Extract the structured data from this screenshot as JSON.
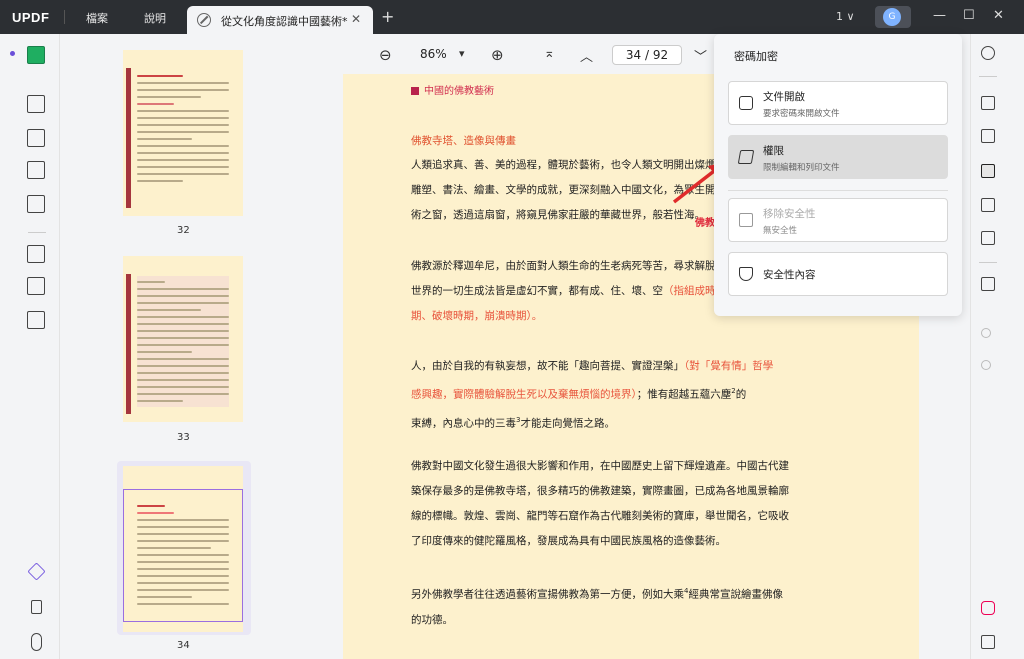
{
  "app": {
    "logo": "UPDF",
    "menu_file": "檔案",
    "menu_help": "說明",
    "tab_title": "從文化角度認識中國藝術*",
    "tab_close": "✕",
    "add_tab": "+",
    "page_count": "1 ∨",
    "avatar_initial": "G",
    "minimize": "—",
    "maximize": "☐",
    "close": "✕"
  },
  "toolbar": {
    "zoom_out": "⊖",
    "zoom": "86%",
    "zoom_dropdown": "▾",
    "zoom_in": "⊕",
    "first_page": "⌅",
    "prev_page": "︿",
    "page_input": "34 / 92",
    "next_page": "﹀"
  },
  "thumbnails": [
    {
      "label": "32"
    },
    {
      "label": "33"
    },
    {
      "label": "34"
    }
  ],
  "document": {
    "heading": "中國的佛教藝術",
    "subheading": "佛教寺塔、造像與傳畫",
    "p1": [
      "人類追求真、善、美的過程，體現於藝術，也令人類文明開出燦爛之花。",
      "雕塑、書法、繪畫、文學的成就，更深刻融入中國文化，為眾生開啟一扇藝",
      "術之窗，透過這扇窗，將窺見佛家莊嚴的華藏世界，般若性海。"
    ],
    "red_label": "佛教",
    "p2a": "佛教源於釋迦牟尼，由於面對人類生命的生老病死等苦，尋求解脫之道。",
    "p2b": "世界的一切生成法皆是虛幻不實，都有成、住、壞、空",
    "p2b_red": "（指組成時",
    "p2c_red": "期、破壞時期，崩潰時期）。",
    "p3a": "人，由於自我的有執妄想，故不能「趣向菩提、實證涅槃」",
    "p3a_red": "（對「覺有情」哲學",
    "p3b_red": "感興趣，實際體驗解脫生死以及棄無煩惱的境界）",
    "p3b": "；惟有超越五蘊六塵",
    "p3b_sup": "2",
    "p3b_end": "的",
    "p3c": "束縛，內息心中的三毒",
    "p3c_sup": "3",
    "p3c_end": "才能走向覺悟之路。",
    "p4": [
      "佛教對中國文化發生過很大影響和作用，在中國歷史上留下輝煌遺產。中國古代建",
      "築保存最多的是佛教寺塔，很多精巧的佛教建築，實際畫圖，已成為各地風景輪廓",
      "線的標幟。敦煌、雲崗、龍門等石窟作為古代雕刻美術的寶庫，舉世聞名，它吸收",
      "了印度傳來的健陀羅風格，發展成為具有中國民族風格的造像藝術。"
    ],
    "p5": [
      "另外佛教學者往往透過藝術宣揚佛教為第一方便，例如大乘",
      "的功德。"
    ],
    "p5_sup": "4",
    "p5_end": "經典常宣說繪畫佛像"
  },
  "security_panel": {
    "title": "密碼加密",
    "open_doc": {
      "label": "文件開啟",
      "desc": "要求密碼來開啟文件"
    },
    "permissions": {
      "label": "權限",
      "desc": "限制編輯和列印文件"
    },
    "remove": {
      "label": "移除安全性",
      "desc": "無安全性"
    },
    "properties": {
      "label": "安全性內容"
    }
  },
  "colors": {
    "accent": "#1fae61",
    "page_bg": "#fdf1cd",
    "red_text": "#e8543c"
  }
}
